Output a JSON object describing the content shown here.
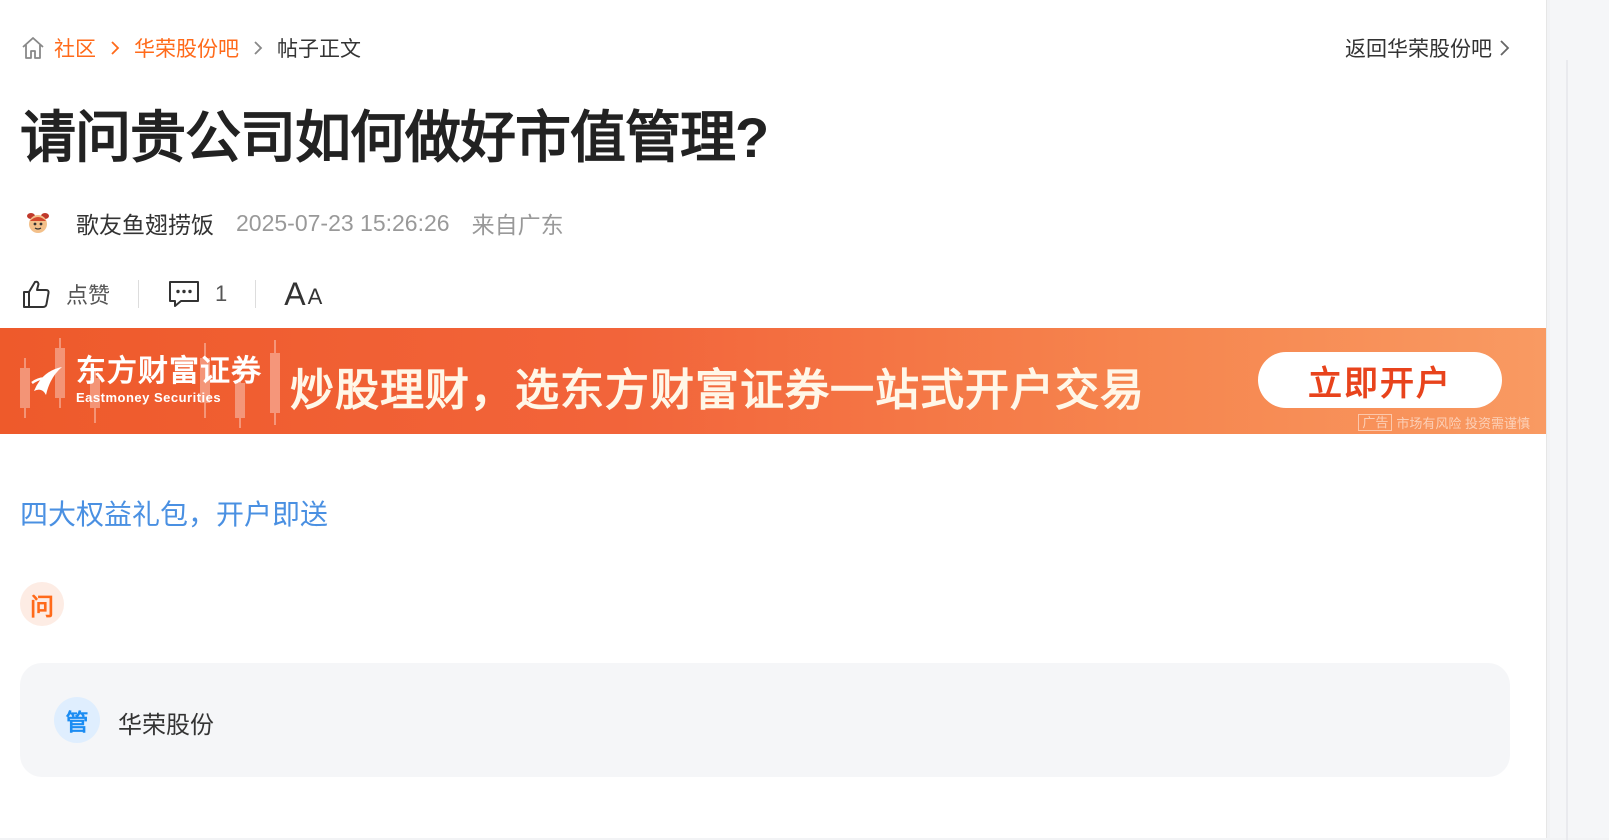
{
  "breadcrumb": {
    "home_icon": "home-icon",
    "items": [
      "社区",
      "华荣股份吧",
      "帖子正文"
    ],
    "back_label": "返回华荣股份吧"
  },
  "post": {
    "title": "请问贵公司如何做好市值管理?",
    "author": "歌友鱼翅捞饭",
    "time": "2025-07-23 15:26:26",
    "location": "来自广东",
    "avatar_icon": "cartoon-avatar-icon"
  },
  "actions": {
    "like_label": "点赞",
    "comment_count": "1",
    "font_big": "A",
    "font_small": "A"
  },
  "banner": {
    "brand_cn": "东方财富证券",
    "brand_en": "Eastmoney Securities",
    "slogan": "炒股理财，选东方财富证券一站式开户交易",
    "button_label": "立即开户",
    "ad_label": "广告",
    "risk_note": "市场有风险 投资需谨慎",
    "colors": {
      "start": "#ee5a2b",
      "end": "#f99a62",
      "button_text": "#e8431c"
    }
  },
  "promo_link": "四大权益礼包，开户即送",
  "question_badge": "问",
  "reply": {
    "badge": "管",
    "name": "华荣股份"
  },
  "colors": {
    "accent": "#ff6a1a",
    "link_blue": "#4a90e2",
    "badge_blue": "#1b8cf2"
  }
}
